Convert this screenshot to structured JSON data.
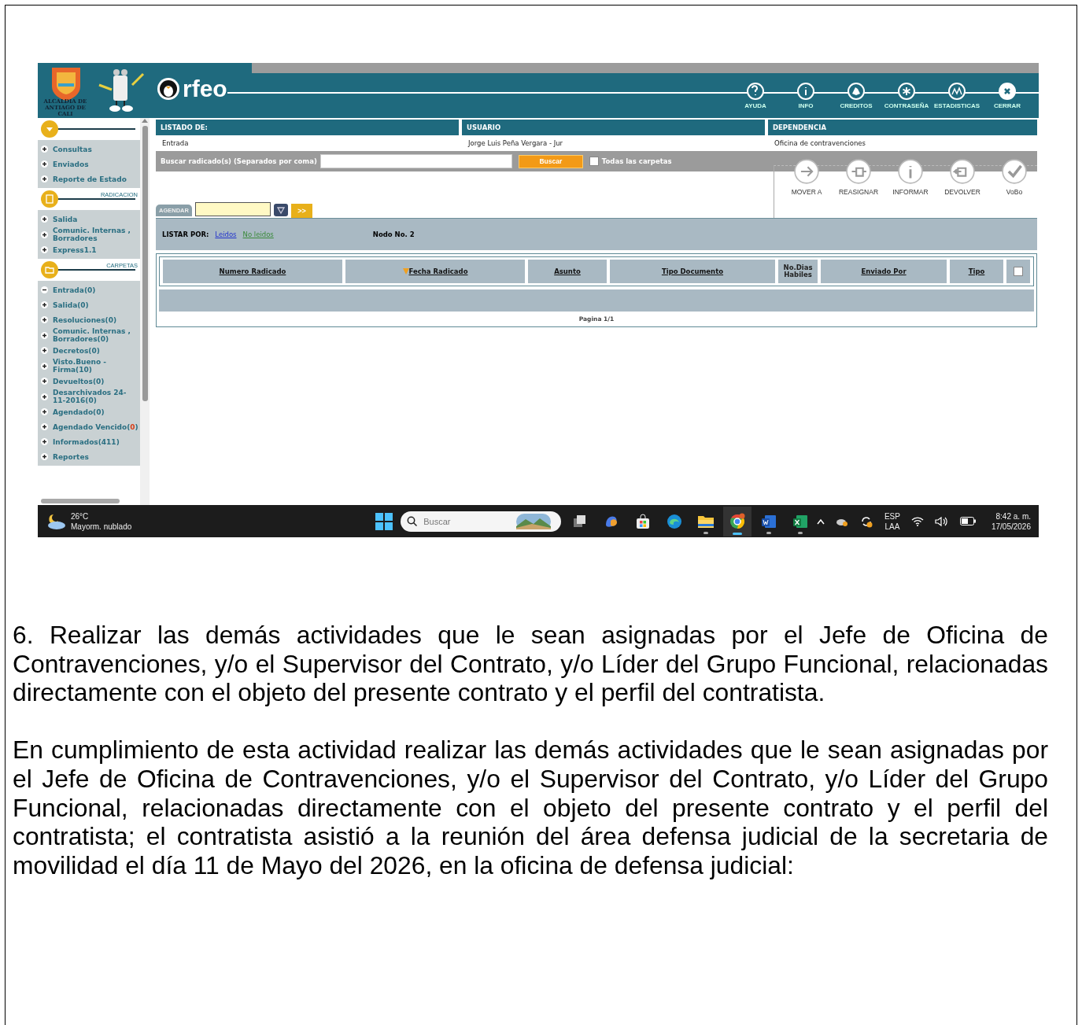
{
  "app": {
    "logo_caption": [
      "ALCALDIA DE",
      "ANTIAGO DE CALI"
    ],
    "brand": "rfeo",
    "top_actions": [
      {
        "label": "AYUDA",
        "kind": "help"
      },
      {
        "label": "INFO",
        "kind": "info"
      },
      {
        "label": "CREDITOS",
        "kind": "hand"
      },
      {
        "label": "CONTRASEÑA",
        "kind": "star"
      },
      {
        "label": "ESTADISTICAS",
        "kind": "chart"
      },
      {
        "label": "CERRAR",
        "kind": "close"
      }
    ]
  },
  "sidebar": {
    "sections": [
      {
        "kind": "menu",
        "items": [
          {
            "label": "Consultas",
            "expanded": false
          },
          {
            "label": "Enviados",
            "expanded": false
          },
          {
            "label": "Reporte de Estado",
            "expanded": false
          }
        ]
      },
      {
        "kind": "file",
        "title": "RADICACION",
        "items": [
          {
            "label": "Salida",
            "expanded": false
          },
          {
            "label": "Comunic. Internas , Borradores",
            "expanded": false
          },
          {
            "label": "Express1.1",
            "expanded": false
          }
        ]
      },
      {
        "kind": "folder",
        "title": "CARPETAS",
        "items": [
          {
            "label": "Entrada(0)",
            "expanded": true
          },
          {
            "label": "Salida(0)",
            "expanded": false
          },
          {
            "label": "Resoluciones(0)",
            "expanded": false
          },
          {
            "label": "Comunic. Internas , Borradores(0)",
            "expanded": false
          },
          {
            "label": "Decretos(0)",
            "expanded": false
          },
          {
            "label": "Visto.Bueno - Firma(10)",
            "expanded": false
          },
          {
            "label": "Devueltos(0)",
            "expanded": false
          },
          {
            "label": "Desarchivados 24-11-2016(0)",
            "expanded": false
          },
          {
            "label": "Agendado(0)",
            "expanded": false
          },
          {
            "label": "Agendado Vencido(",
            "count": "0",
            "after": ")",
            "alert": true,
            "expanded": false
          },
          {
            "label": "Informados(411)",
            "expanded": false
          },
          {
            "label": "Reportes",
            "expanded": false
          }
        ]
      }
    ]
  },
  "info": {
    "columns": [
      {
        "heading": "LISTADO DE:",
        "value": "Entrada"
      },
      {
        "heading": "USUARIO",
        "value": "Jorge Luis Peña Vergara - Jur"
      },
      {
        "heading": "DEPENDENCIA",
        "value": "Oficina de contravenciones"
      }
    ]
  },
  "search": {
    "label": "Buscar radicado(s) (Separados por coma)",
    "button": "Buscar",
    "all_folders": {
      "label": "Todas las carpetas",
      "checked": false
    }
  },
  "agenda": {
    "tab": "AGENDAR",
    "go": ">>"
  },
  "actions": [
    {
      "label": "MOVER A",
      "kind": "move"
    },
    {
      "label": "REASIGNAR",
      "kind": "reassign"
    },
    {
      "label": "INFORMAR",
      "kind": "info"
    },
    {
      "label": "DEVOLVER",
      "kind": "return"
    },
    {
      "label": "VoBo",
      "kind": "check"
    }
  ],
  "list_by": {
    "label": "LISTAR POR:",
    "links": [
      {
        "label": "Leidos",
        "visited": false
      },
      {
        "label": "No leidos",
        "visited": true
      }
    ],
    "node": "Nodo No. 2"
  },
  "table": {
    "columns": [
      {
        "label": "Numero Radicado",
        "link": true,
        "sorted": false
      },
      {
        "label": "Fecha Radicado",
        "link": true,
        "sorted": true
      },
      {
        "label": "Asunto",
        "link": true,
        "sorted": false
      },
      {
        "label": "Tipo Documento",
        "link": true,
        "sorted": false
      },
      {
        "label": "No.Dias Habiles",
        "link": false,
        "sorted": false
      },
      {
        "label": "Enviado Por",
        "link": true,
        "sorted": false
      },
      {
        "label": "Tipo",
        "link": true,
        "sorted": false
      }
    ],
    "select_all": {
      "checked": false
    },
    "pager": "Pagina 1/1"
  },
  "taskbar": {
    "weather": {
      "temp": "26°C",
      "desc": "Mayorm. nublado"
    },
    "search_placeholder": "Buscar",
    "apps": [
      {
        "kind": "taskview",
        "active": false,
        "open": false
      },
      {
        "kind": "copilot",
        "active": false,
        "open": false
      },
      {
        "kind": "store",
        "active": false,
        "open": false
      },
      {
        "kind": "edge",
        "active": false,
        "open": false
      },
      {
        "kind": "folder",
        "active": false,
        "open": true
      },
      {
        "kind": "chrome",
        "active": true,
        "open": true
      },
      {
        "kind": "word",
        "active": false,
        "open": true
      },
      {
        "kind": "excel",
        "active": false,
        "open": true
      }
    ],
    "lang": [
      "ESP",
      "LAA"
    ],
    "time": "8:42 a. m.",
    "date": "17/05/2026"
  },
  "document": {
    "paragraphs": [
      "6. Realizar las demás actividades que le sean asignadas por el Jefe de Oficina de Contravenciones, y/o el Supervisor del Contrato, y/o Líder del Grupo Funcional, relacionadas directamente con el objeto del presente contrato y el perfil del contratista.",
      "En cumplimiento de esta actividad realizar las demás actividades que le sean asignadas por el Jefe de Oficina de Contravenciones, y/o el Supervisor del Contrato, y/o Líder del Grupo Funcional, relacionadas directamente con el objeto del presente contrato y el perfil del contratista; el contratista asistió a la reunión del área defensa judicial de la secretaria de movilidad  el día 11 de Mayo del 2026, en la oficina de defensa judicial:"
    ]
  }
}
